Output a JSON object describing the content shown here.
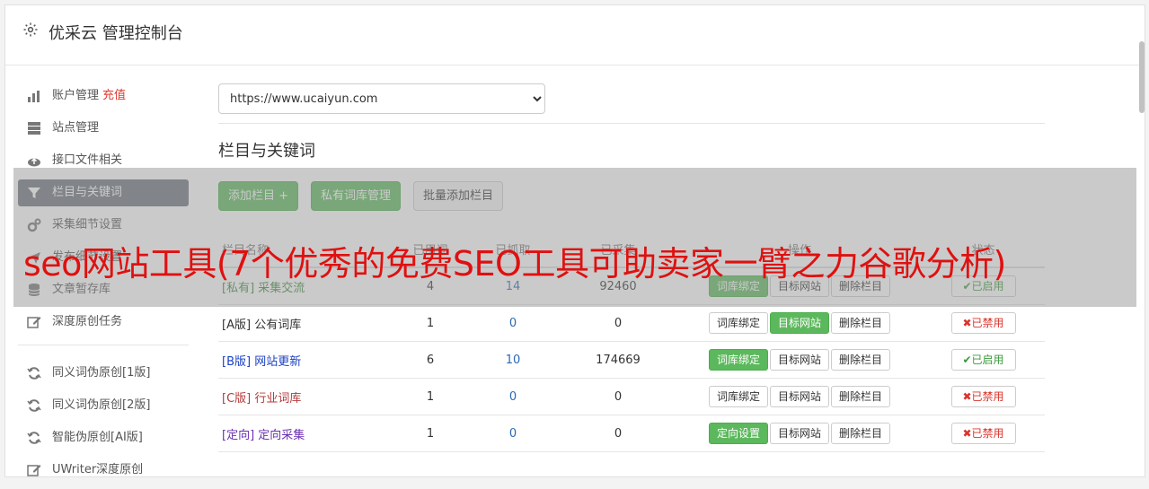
{
  "header": {
    "title": "优采云 管理控制台",
    "icon": "gear-icon"
  },
  "sidebar": {
    "items": [
      {
        "label": "账户管理",
        "extra": "充值",
        "icon": "bar-chart-icon"
      },
      {
        "label": "站点管理",
        "icon": "server-icon"
      },
      {
        "label": "接口文件相关",
        "icon": "cloud-upload-icon"
      },
      {
        "label": "栏目与关键词",
        "icon": "filter-icon",
        "active": true
      },
      {
        "label": "采集细节设置",
        "icon": "cogs-icon"
      },
      {
        "label": "发布细节设置",
        "icon": "send-icon"
      },
      {
        "label": "文章暂存库",
        "icon": "database-icon"
      },
      {
        "label": "深度原创任务",
        "icon": "edit-icon"
      }
    ],
    "tools": [
      {
        "label": "同义词伪原创[1版]",
        "icon": "refresh-icon"
      },
      {
        "label": "同义词伪原创[2版]",
        "icon": "refresh-icon"
      },
      {
        "label": "智能伪原创[AI版]",
        "icon": "refresh-icon"
      },
      {
        "label": "UWriter深度原创",
        "icon": "edit-icon"
      }
    ]
  },
  "main": {
    "site_select": {
      "value": "https://www.ucaiyun.com"
    },
    "section_title": "栏目与关键词",
    "buttons": {
      "add_column": "添加栏目 +",
      "private_lib": "私有词库管理",
      "batch_add": "批量添加栏目"
    },
    "table": {
      "headers": [
        "栏目名称",
        "已用词",
        "已抓取",
        "已采集",
        "操作",
        "状态"
      ],
      "rows": [
        {
          "tag": "[私有]",
          "name": "采集交流",
          "used": "4",
          "fetched": "14",
          "collected": "92460",
          "op1": "词库绑定",
          "op2": "目标网站",
          "op3": "删除栏目",
          "status": "已启用"
        },
        {
          "tag": "[A版]",
          "name": "公有词库",
          "used": "1",
          "fetched": "0",
          "collected": "0",
          "op1": "词库绑定",
          "op2": "目标网站",
          "op3": "删除栏目",
          "status": "已禁用"
        },
        {
          "tag": "[B版]",
          "name": "网站更新",
          "used": "6",
          "fetched": "10",
          "collected": "174669",
          "op1": "词库绑定",
          "op2": "目标网站",
          "op3": "删除栏目",
          "status": "已启用"
        },
        {
          "tag": "[C版]",
          "name": "行业词库",
          "used": "1",
          "fetched": "0",
          "collected": "0",
          "op1": "词库绑定",
          "op2": "目标网站",
          "op3": "删除栏目",
          "status": "已禁用"
        },
        {
          "tag": "[定向]",
          "name": "定向采集",
          "used": "1",
          "fetched": "0",
          "collected": "0",
          "op1": "定向设置",
          "op2": "目标网站",
          "op3": "删除栏目",
          "status": "已禁用"
        }
      ]
    }
  },
  "overlay": {
    "headline": "seo网站工具(7个优秀的免费SEO工具可助卖家一臂之力谷歌分析)"
  },
  "colors": {
    "green": "#5cb85c",
    "active_nav": "#6c737b",
    "headline": "#e01010",
    "private_tag": "#3c8a3c",
    "a_tag": "#333333",
    "b_tag": "#1a3fc4",
    "c_tag": "#b33a3a",
    "directed_tag": "#6b2fb3"
  }
}
